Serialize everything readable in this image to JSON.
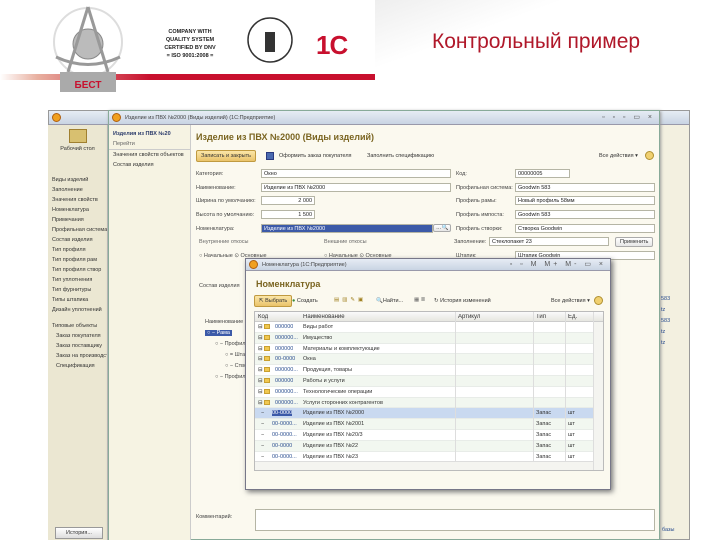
{
  "slide": {
    "title": "Контрольный пример",
    "logo_group": "Группа компаний БЕСТ",
    "cert_text": [
      "COMPANY WITH",
      "QUALITY SYSTEM",
      "CERTIFIED BY DNV",
      "= ISO 9001:2008 ="
    ],
    "logo_1c": "1С"
  },
  "app": {
    "left_button": "Рабочий стол",
    "left_items": [
      "Виды изделий",
      "Заполнение",
      "Значения свойств",
      "Номенклатура",
      "Примечания",
      "Профильная система",
      "Состав изделия",
      "Тип профиля",
      "Тип профиля рам",
      "Тип профиля створ",
      "Тип уплотнения",
      "Тип фурнитуры",
      "Типы штапика",
      "Дизайн уплотнений"
    ],
    "service_header": "Типовые объекты",
    "service_items": [
      "Заказ покупателя",
      "Заказ поставщику",
      "Заказ на производство",
      "Спецификация"
    ],
    "history_button": "История..."
  },
  "form": {
    "window_title": "Изделие из ПВХ №2000 (Виды изделий) (1С:Предприятие)",
    "nav_title": "Изделия из ПВХ №20",
    "nav_goto": "Перейти",
    "nav_items": [
      "Значения свойств объектов",
      "Состав изделия"
    ],
    "heading": "Изделие из ПВХ №2000 (Виды изделий)",
    "toolbar": {
      "save_close": "Записать и закрыть",
      "order": "Оформить заказ покупателя",
      "spec": "Заполнить спецификацию",
      "all_actions": "Все действия ▾"
    },
    "fields": {
      "category_label": "Категория:",
      "category": "Окно",
      "name_label": "Наименование:",
      "name": "Изделие из ПВХ №2000",
      "width_label": "Ширина по умолчанию:",
      "width": "2 000",
      "height_label": "Высота по умолчанию:",
      "height": "1 500",
      "nomen_label": "Номенклатура:",
      "nomen": "Изделие из ПВХ №2000",
      "code_label": "Код:",
      "code": "00000005",
      "profsys_label": "Профильная система:",
      "profsys": "Goodwin 583",
      "frame_label": "Профиль рамы:",
      "frame": "Новый профиль 58мм",
      "impost_label": "Профиль импоста:",
      "impost": "Goodwin 583",
      "sash_label": "Профиль створки:",
      "sash": "Створка Goodwin",
      "fill_label": "Заполнение:",
      "fill": "Стеклопакет 23",
      "apply": "Применить",
      "shtapik_label": "Штапик:",
      "shtapik": "Штапик Goodwin",
      "inner_slopes": "Внутренние откосы",
      "outer_slopes": "Внешние откосы",
      "radio_a": "Начальные",
      "radio_b": "Основные",
      "composition": "Состав изделия",
      "col_name": "Наименование",
      "tree_root": "Рама",
      "tree_items": [
        "Профиль",
        "Штапик",
        "Створка",
        "Профиль"
      ],
      "comment_label": "Комментарий:",
      "status": "базы",
      "side_values": [
        "583",
        "tz",
        "583",
        "tz",
        "tz"
      ]
    }
  },
  "popup": {
    "window_title": "Номенклатура (1С:Предприятие)",
    "heading": "Номенклатура",
    "toolbar": {
      "select": "Выбрать",
      "create": "Создать",
      "find": "Найти...",
      "history": "История изменений",
      "all_actions": "Все действия ▾"
    },
    "columns": [
      "Код",
      "Наименование",
      "Артикул",
      "Тип",
      "Ед."
    ],
    "rows": [
      {
        "folder": true,
        "code": "000000",
        "name": "Виды работ",
        "type": "",
        "unit": ""
      },
      {
        "folder": true,
        "code": "000000...",
        "name": "Имущество",
        "type": "",
        "unit": ""
      },
      {
        "folder": true,
        "code": "000000",
        "name": "Материалы и комплектующие",
        "type": "",
        "unit": ""
      },
      {
        "folder": true,
        "code": "00-0000",
        "name": "Окна",
        "type": "",
        "unit": ""
      },
      {
        "folder": true,
        "code": "000000...",
        "name": "Продукция, товары",
        "type": "",
        "unit": ""
      },
      {
        "folder": true,
        "code": "000000",
        "name": "Работы и услуги",
        "type": "",
        "unit": ""
      },
      {
        "folder": true,
        "code": "000000...",
        "name": "Технологические операции",
        "type": "",
        "unit": ""
      },
      {
        "folder": true,
        "code": "000000...",
        "name": "Услуги сторонних контрагентов",
        "type": "",
        "unit": ""
      },
      {
        "folder": false,
        "code": "00-0000",
        "name": "Изделие из ПВХ №2000",
        "type": "Запас",
        "unit": "шт",
        "selected": true
      },
      {
        "folder": false,
        "code": "00-0000...",
        "name": "Изделие из ПВХ №2001",
        "type": "Запас",
        "unit": "шт"
      },
      {
        "folder": false,
        "code": "00-0000...",
        "name": "Изделие из ПВХ №20/3",
        "type": "Запас",
        "unit": "шт"
      },
      {
        "folder": false,
        "code": "00-0000",
        "name": "Изделие из ПВХ №22",
        "type": "Запас",
        "unit": "шт"
      },
      {
        "folder": false,
        "code": "00-0000...",
        "name": "Изделие из ПВХ №23",
        "type": "Запас",
        "unit": "шт"
      }
    ]
  }
}
